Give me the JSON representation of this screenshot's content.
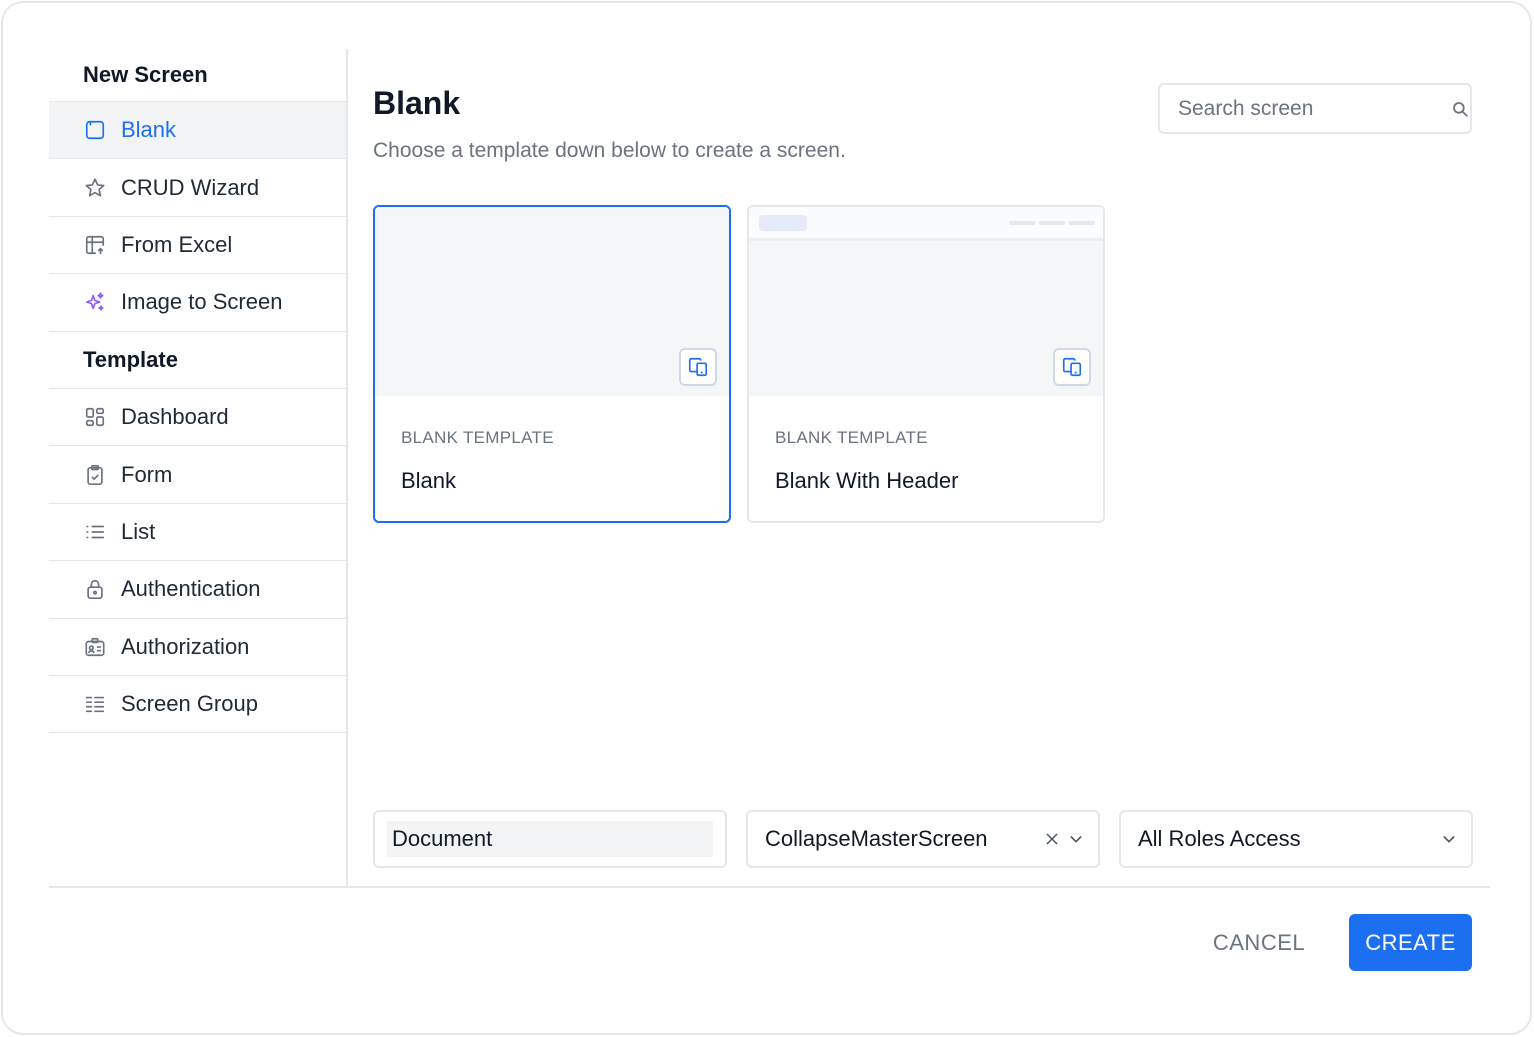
{
  "sidebar": {
    "new_screen_heading": "New Screen",
    "new_screen_items": [
      {
        "label": "Blank",
        "icon": "window-icon",
        "active": true
      },
      {
        "label": "CRUD Wizard",
        "icon": "star-icon"
      },
      {
        "label": "From Excel",
        "icon": "table-import-icon"
      },
      {
        "label": "Image to Screen",
        "icon": "sparkles-icon"
      }
    ],
    "template_heading": "Template",
    "template_items": [
      {
        "label": "Dashboard",
        "icon": "dashboard-icon"
      },
      {
        "label": "Form",
        "icon": "clipboard-check-icon"
      },
      {
        "label": "List",
        "icon": "list-icon"
      },
      {
        "label": "Authentication",
        "icon": "lock-icon"
      },
      {
        "label": "Authorization",
        "icon": "id-badge-icon"
      },
      {
        "label": "Screen Group",
        "icon": "group-list-icon"
      }
    ]
  },
  "main": {
    "title": "Blank",
    "subtitle": "Choose a template down below to create a screen.",
    "search_placeholder": "Search screen",
    "cards": [
      {
        "kicker": "BLANK TEMPLATE",
        "name": "Blank",
        "selected": true
      },
      {
        "kicker": "BLANK TEMPLATE",
        "name": "Blank With Header",
        "selected": false
      }
    ]
  },
  "fields": {
    "document": "Document",
    "master_screen": "CollapseMasterScreen",
    "roles": "All Roles Access"
  },
  "footer": {
    "cancel_label": "CANCEL",
    "create_label": "CREATE"
  },
  "colors": {
    "accent": "#1d6ff2",
    "ai_accent": "#8b5cf6",
    "border": "#e5e7eb",
    "muted_text": "#6b7280"
  }
}
